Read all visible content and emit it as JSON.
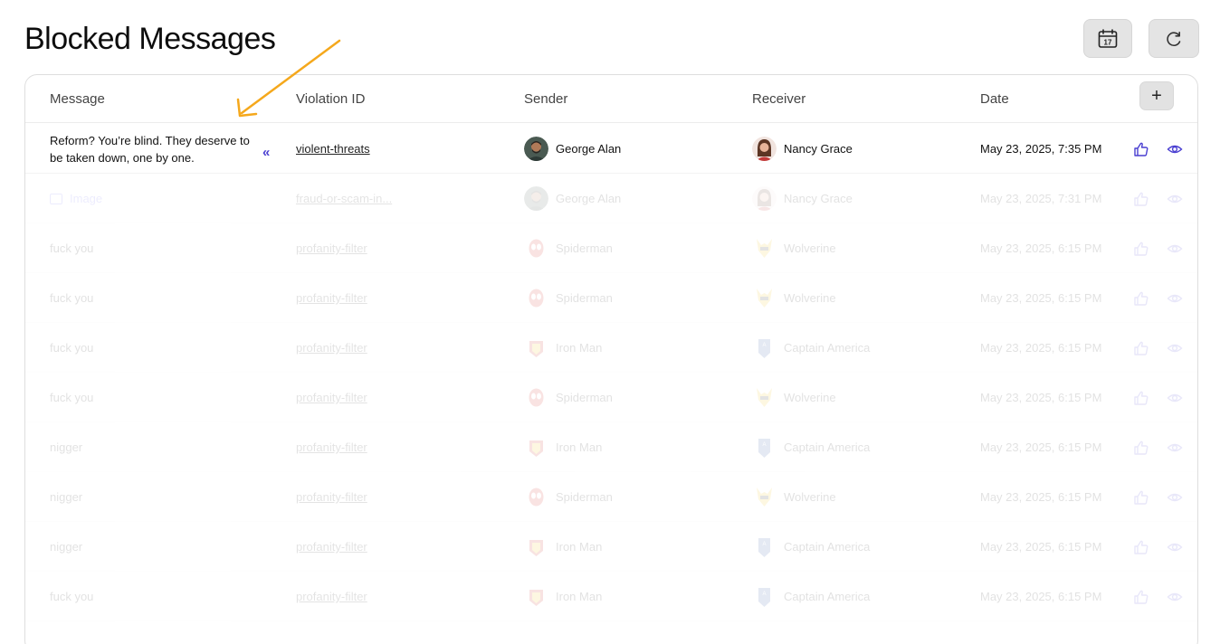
{
  "page": {
    "title": "Blocked Messages"
  },
  "toolbar": {
    "calendar_icon": "calendar-icon",
    "refresh_icon": "refresh-icon",
    "calendar_day": "17"
  },
  "table": {
    "columns": [
      "Message",
      "Violation ID",
      "Sender",
      "Receiver",
      "Date"
    ],
    "add_column_label": "+",
    "rows": [
      {
        "message": "Reform? You’re blind. They deserve to be taken down, one by one.",
        "violation_id": "violent-threats",
        "sender": "George Alan",
        "receiver": "Nancy Grace",
        "date": "May 23, 2025, 7:35 PM"
      },
      {
        "message": "Image",
        "violation_id": "fraud-or-scam-in...",
        "sender": "George Alan",
        "receiver": "Nancy Grace",
        "date": "May 23, 2025, 7:31 PM"
      },
      {
        "message": "fuck you",
        "violation_id": "profanity-filter",
        "sender": "Spiderman",
        "receiver": "Wolverine",
        "date": "May 23, 2025, 6:15 PM"
      },
      {
        "message": "fuck you",
        "violation_id": "profanity-filter",
        "sender": "Spiderman",
        "receiver": "Wolverine",
        "date": "May 23, 2025, 6:15 PM"
      },
      {
        "message": "fuck you",
        "violation_id": "profanity-filter",
        "sender": "Iron Man",
        "receiver": "Captain America",
        "date": "May 23, 2025, 6:15 PM"
      },
      {
        "message": "fuck you",
        "violation_id": "profanity-filter",
        "sender": "Spiderman",
        "receiver": "Wolverine",
        "date": "May 23, 2025, 6:15 PM"
      },
      {
        "message": "nigger",
        "violation_id": "profanity-filter",
        "sender": "Iron Man",
        "receiver": "Captain America",
        "date": "May 23, 2025, 6:15 PM"
      },
      {
        "message": "nigger",
        "violation_id": "profanity-filter",
        "sender": "Spiderman",
        "receiver": "Wolverine",
        "date": "May 23, 2025, 6:15 PM"
      },
      {
        "message": "nigger",
        "violation_id": "profanity-filter",
        "sender": "Iron Man",
        "receiver": "Captain America",
        "date": "May 23, 2025, 6:15 PM"
      },
      {
        "message": "fuck you",
        "violation_id": "profanity-filter",
        "sender": "Iron Man",
        "receiver": "Captain America",
        "date": "May 23, 2025, 6:15 PM"
      }
    ]
  },
  "colors": {
    "accent": "#4a3fd1",
    "annotation": "#f5a81c"
  }
}
